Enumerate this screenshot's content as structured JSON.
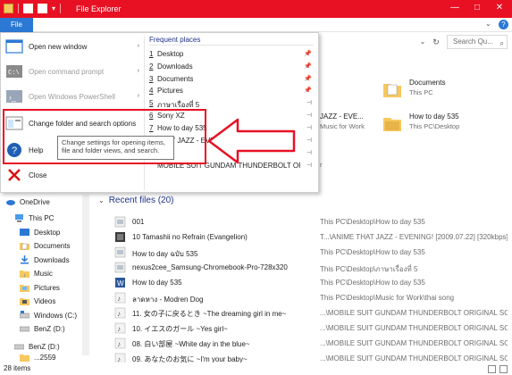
{
  "window": {
    "title": "File Explorer",
    "minimize_glyph": "—",
    "maximize_glyph": "□",
    "close_glyph": "✕"
  },
  "ribbon": {
    "file_tab": "File",
    "expand_glyph": "⌄",
    "help_glyph": "?"
  },
  "address": {
    "dropdown_glyph": "⌄",
    "refresh_glyph": "↻",
    "search_placeholder": "Search Qu...",
    "search_icon": "🔍"
  },
  "colors": {
    "title_bar": "#e81123",
    "file_tab": "#2b79d4",
    "header_blue": "#1e3287",
    "highlight_red": "#e81123"
  },
  "file_menu": {
    "items": [
      {
        "label": "Open new window",
        "icon": "window-icon",
        "enabled": true,
        "has_arrow": true
      },
      {
        "label": "Open command prompt",
        "icon": "command-prompt-icon",
        "enabled": false,
        "has_arrow": true
      },
      {
        "label": "Open Windows PowerShell",
        "icon": "powershell-icon",
        "enabled": false,
        "has_arrow": true
      },
      {
        "label": "Change folder and search options",
        "icon": "folder-options-icon",
        "enabled": true,
        "has_arrow": false
      },
      {
        "label": "Help",
        "icon": "help-icon",
        "enabled": true,
        "has_arrow": true
      },
      {
        "label": "Close",
        "icon": "close-icon",
        "enabled": true,
        "has_arrow": false
      }
    ],
    "frequent_title": "Frequent places",
    "frequent": [
      {
        "num": "1",
        "label": "Desktop"
      },
      {
        "num": "2",
        "label": "Downloads"
      },
      {
        "num": "3",
        "label": "Documents"
      },
      {
        "num": "4",
        "label": "Pictures"
      },
      {
        "num": "5",
        "label": "ภาษาเรื่องที่ 5"
      },
      {
        "num": "6",
        "label": "Sony XZ"
      },
      {
        "num": "7",
        "label": "How to day 535"
      },
      {
        "num": "8",
        "label": "THAT JAZZ - EVENING! [2009.07.22] [32..."
      },
      {
        "num": "",
        "label": ""
      },
      {
        "num": "",
        "label": "MOBILE SUIT GUNDAM THUNDERBOLT ORIGIN..."
      }
    ],
    "tooltip": "Change settings for opening items, file and folder views, and search."
  },
  "frequent_folders": [
    {
      "name": "Documents",
      "sub": "This PC"
    },
    {
      "name": "How to day 535",
      "sub": "This PC\\Desktop"
    },
    {
      "name": "JAZZ - EVE...",
      "sub": "Music for Work"
    },
    {
      "name": "",
      "sub": "r"
    }
  ],
  "nav": {
    "items": [
      {
        "label": "OneDrive",
        "icon": "cloud-icon"
      },
      {
        "label": "This PC",
        "icon": "computer-icon"
      },
      {
        "label": "Desktop",
        "icon": "desktop-icon"
      },
      {
        "label": "Documents",
        "icon": "documents-icon"
      },
      {
        "label": "Downloads",
        "icon": "downloads-icon"
      },
      {
        "label": "Music",
        "icon": "music-icon"
      },
      {
        "label": "Pictures",
        "icon": "pictures-icon"
      },
      {
        "label": "Videos",
        "icon": "videos-icon"
      },
      {
        "label": "Windows (C:)",
        "icon": "drive-icon"
      },
      {
        "label": "BenZ (D:)",
        "icon": "drive-icon"
      },
      {
        "label": "BenZ (D:)",
        "icon": "drive-icon"
      },
      {
        "label": "...2559",
        "icon": "folder-icon"
      }
    ]
  },
  "recent": {
    "header": "Recent files (20)",
    "chevron": "⌄",
    "files": [
      {
        "name": "001",
        "path": "This PC\\Desktop\\How to day 535",
        "icon": "image-file-icon"
      },
      {
        "name": "10 Tamashii no Refrain (Evangelion)",
        "path": "T...\\ANIME THAT JAZZ - EVENING! [2009.07.22] [320kbps]",
        "icon": "audio-file-icon"
      },
      {
        "name": "How to day ฉบับ 535",
        "path": "This PC\\Desktop\\How to day 535",
        "icon": "image-file-icon"
      },
      {
        "name": "nexus2cee_Samsung-Chromebook-Pro-728x320",
        "path": "This PC\\Desktop\\ภาษาเรื่องที่ 5",
        "icon": "image-file-icon"
      },
      {
        "name": "How to day 535",
        "path": "This PC\\Desktop\\How to day 535",
        "icon": "word-file-icon"
      },
      {
        "name": "ลาดหาง - Modren Dog",
        "path": "This PC\\Desktop\\Music for Work\\thai song",
        "icon": "audio-file-icon"
      },
      {
        "name": "11. 女の子に戻るとき ~The dreaming girl in me~",
        "path": "...\\MOBILE SUIT GUNDAM THUNDERBOLT ORIGINAL SO...",
        "icon": "audio-file-icon"
      },
      {
        "name": "10. イエスのガール ~Yes girl~",
        "path": "...\\MOBILE SUIT GUNDAM THUNDERBOLT ORIGINAL SO...",
        "icon": "audio-file-icon"
      },
      {
        "name": "08. 白い部屋 ~White day in the blue~",
        "path": "...\\MOBILE SUIT GUNDAM THUNDERBOLT ORIGINAL SO...",
        "icon": "audio-file-icon"
      },
      {
        "name": "09. あなたのお気に ~I'm your baby~",
        "path": "...\\MOBILE SUIT GUNDAM THUNDERBOLT ORIGINAL SO...",
        "icon": "audio-file-icon"
      }
    ]
  },
  "status": {
    "items_count": "28 items"
  }
}
